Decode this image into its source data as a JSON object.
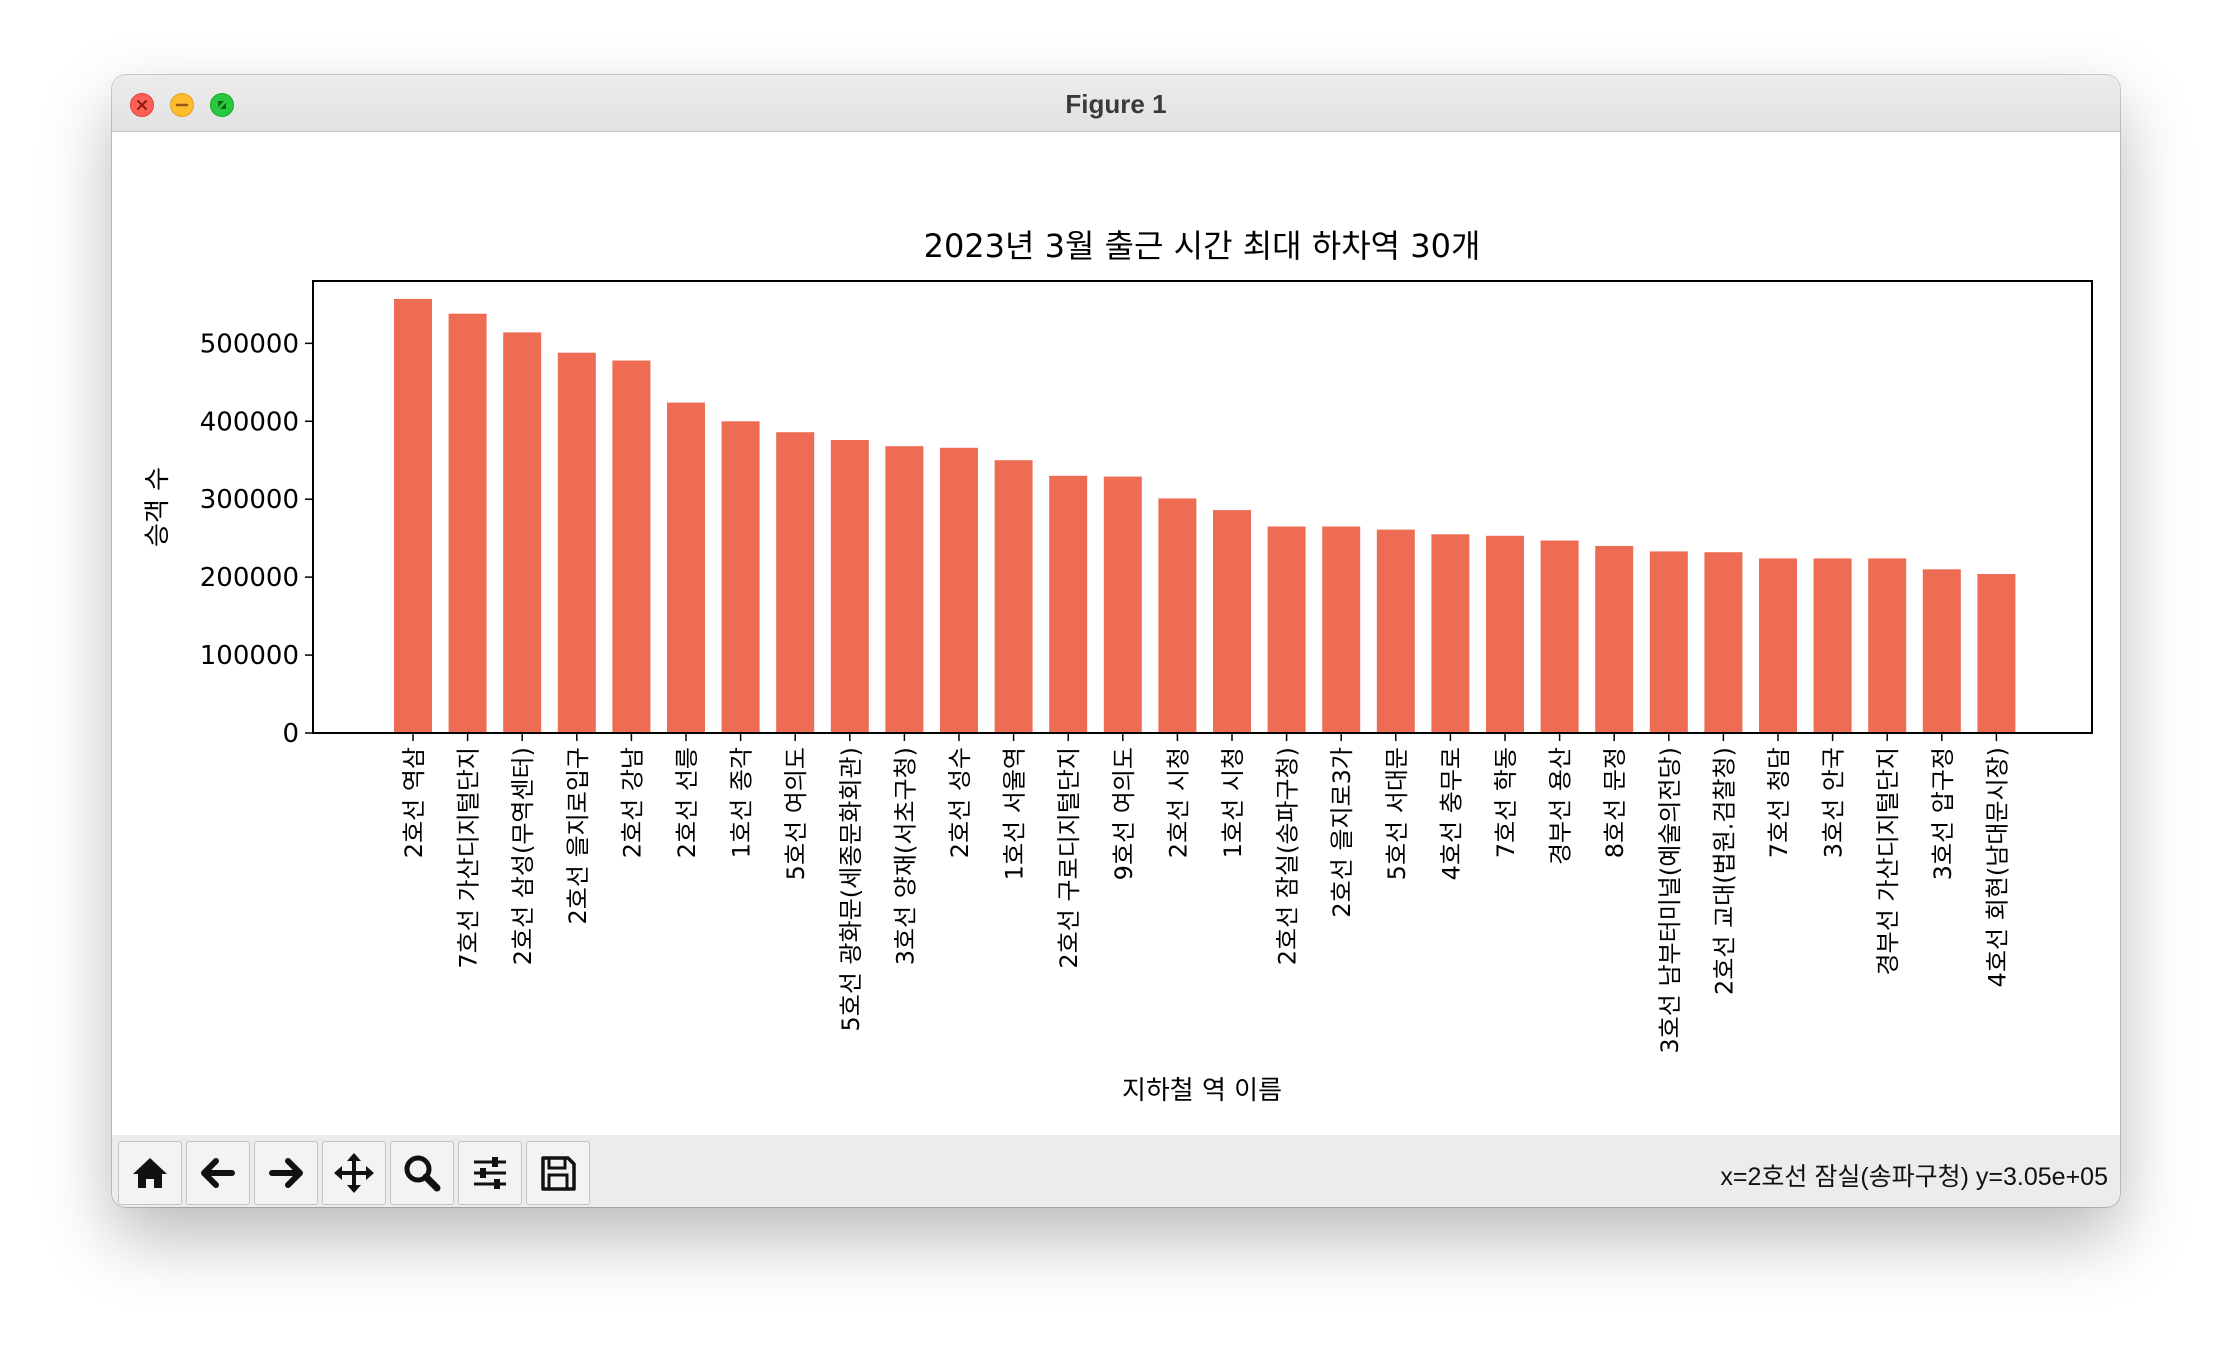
{
  "window": {
    "title": "Figure 1"
  },
  "toolbar": {
    "buttons": [
      {
        "name": "home-button",
        "icon": "home-icon"
      },
      {
        "name": "back-button",
        "icon": "arrow-left-icon"
      },
      {
        "name": "forward-button",
        "icon": "arrow-right-icon"
      },
      {
        "name": "pan-button",
        "icon": "move-icon"
      },
      {
        "name": "zoom-button",
        "icon": "search-icon"
      },
      {
        "name": "configure-subplots-button",
        "icon": "sliders-icon"
      },
      {
        "name": "save-button",
        "icon": "floppy-disk-icon"
      }
    ],
    "status": "x=2호선 잠실(송파구청) y=3.05e+05"
  },
  "chart_data": {
    "type": "bar",
    "title": "2023년 3월 출근 시간 최대 하차역 30개",
    "xlabel": "지하철 역 이름",
    "ylabel": "승객 수",
    "bar_color": "#ee6c54",
    "ylim": [
      0,
      580000
    ],
    "yticks": [
      0,
      100000,
      200000,
      300000,
      400000,
      500000
    ],
    "ytick_labels": [
      "0",
      "100000",
      "200000",
      "300000",
      "400000",
      "500000"
    ],
    "categories": [
      "2호선 역삼",
      "7호선 가산디지털단지",
      "2호선 삼성(무역센터)",
      "2호선 을지로입구",
      "2호선 강남",
      "2호선 선릉",
      "1호선 종각",
      "5호선 여의도",
      "5호선 광화문(세종문화회관)",
      "3호선 양재(서초구청)",
      "2호선 성수",
      "1호선 서울역",
      "2호선 구로디지털단지",
      "9호선 여의도",
      "2호선 시청",
      "1호선 시청",
      "2호선 잠실(송파구청)",
      "2호선 을지로3가",
      "5호선 서대문",
      "4호선 충무로",
      "7호선 학동",
      "경부선 용산",
      "8호선 문정",
      "3호선 남부터미널(예술의전당)",
      "2호선 교대(법원.검찰청)",
      "7호선 청담",
      "3호선 안국",
      "경부선 가산디지털단지",
      "3호선 압구정",
      "4호선 회현(남대문시장)"
    ],
    "values": [
      557000,
      538000,
      514000,
      488000,
      478000,
      424000,
      400000,
      386000,
      376000,
      368000,
      366000,
      350000,
      330000,
      329000,
      301000,
      286000,
      265000,
      265000,
      261000,
      255000,
      253000,
      247000,
      240000,
      233000,
      232000,
      224000,
      224000,
      224000,
      210000,
      204000
    ]
  }
}
